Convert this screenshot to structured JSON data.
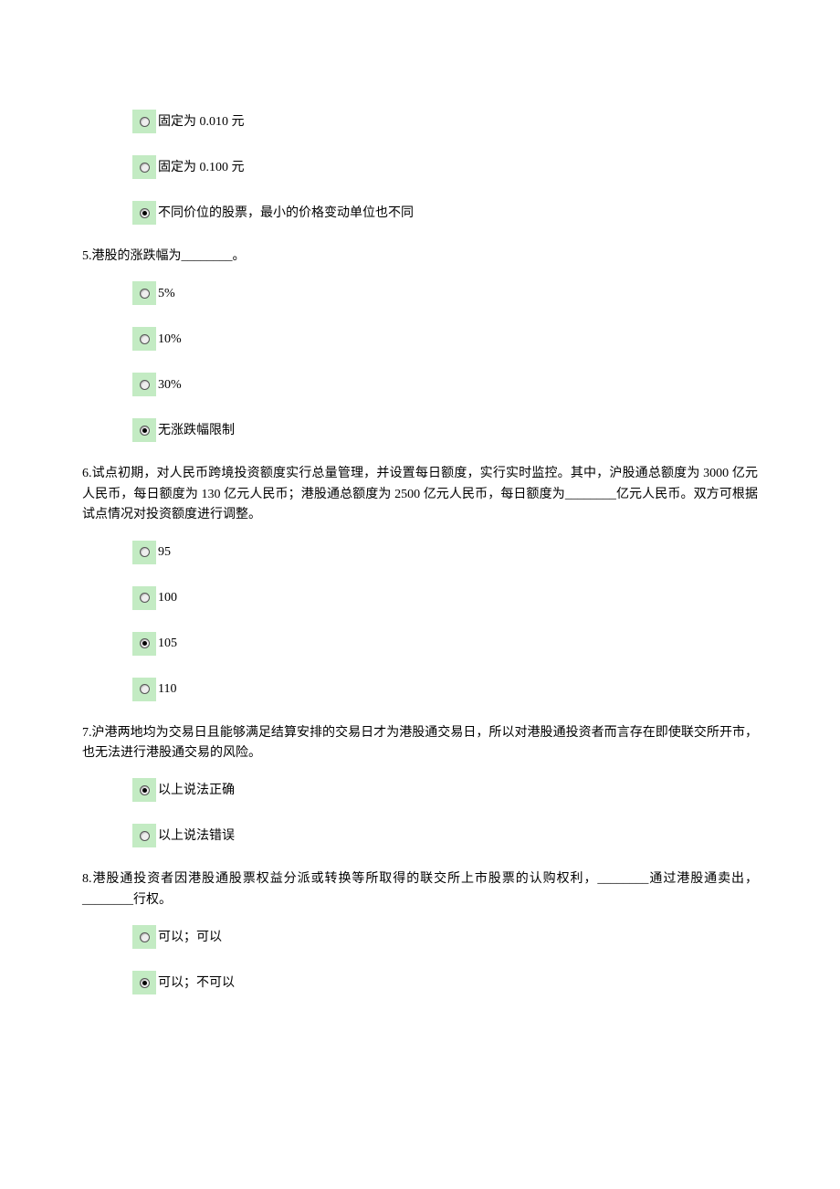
{
  "q4": {
    "options": [
      {
        "label": "固定为 0.010 元",
        "selected": false
      },
      {
        "label": "固定为 0.100 元",
        "selected": false
      },
      {
        "label": "不同价位的股票，最小的价格变动单位也不同",
        "selected": true
      }
    ]
  },
  "q5": {
    "text": "5.港股的涨跌幅为________。",
    "options": [
      {
        "label": "5%",
        "selected": false
      },
      {
        "label": "10%",
        "selected": false
      },
      {
        "label": "30%",
        "selected": false
      },
      {
        "label": "无涨跌幅限制",
        "selected": true
      }
    ]
  },
  "q6": {
    "text": "6.试点初期，对人民币跨境投资额度实行总量管理，并设置每日额度，实行实时监控。其中，沪股通总额度为 3000 亿元人民币，每日额度为 130 亿元人民币；港股通总额度为 2500 亿元人民币，每日额度为________亿元人民币。双方可根据试点情况对投资额度进行调整。",
    "options": [
      {
        "label": "95",
        "selected": false
      },
      {
        "label": "100",
        "selected": false
      },
      {
        "label": "105",
        "selected": true
      },
      {
        "label": "110",
        "selected": false
      }
    ]
  },
  "q7": {
    "text": "7.沪港两地均为交易日且能够满足结算安排的交易日才为港股通交易日，所以对港股通投资者而言存在即使联交所开市，也无法进行港股通交易的风险。",
    "options": [
      {
        "label": "以上说法正确",
        "selected": true
      },
      {
        "label": "以上说法错误",
        "selected": false
      }
    ]
  },
  "q8": {
    "text": "8.港股通投资者因港股通股票权益分派或转换等所取得的联交所上市股票的认购权利，________通过港股通卖出，________行权。",
    "options": [
      {
        "label": "可以；可以",
        "selected": false
      },
      {
        "label": "可以；不可以",
        "selected": true
      }
    ]
  }
}
